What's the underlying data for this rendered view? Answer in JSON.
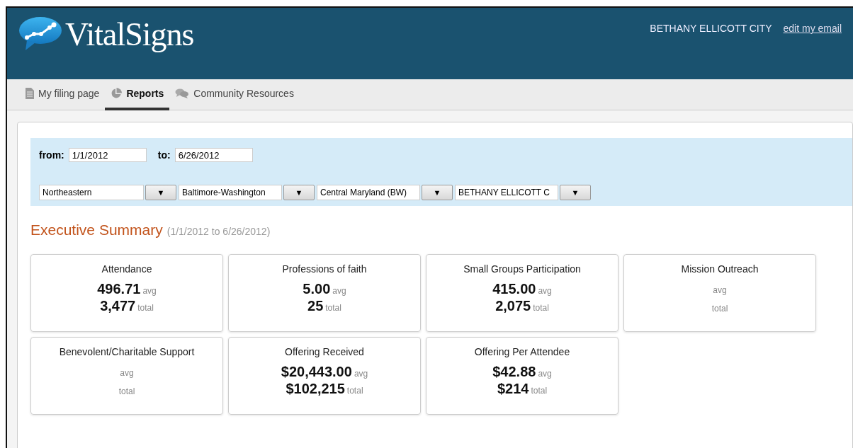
{
  "header": {
    "logo_text": "VitalSigns",
    "user": "BETHANY ELLICOTT CITY",
    "link": "edit my email"
  },
  "nav": [
    {
      "label": "My filing page",
      "selected": false
    },
    {
      "label": "Reports",
      "selected": true
    },
    {
      "label": "Community Resources",
      "selected": false
    }
  ],
  "filters": {
    "from_label": "from:",
    "from_value": "1/1/2012",
    "to_label": "to:",
    "to_value": "6/26/2012",
    "dropdowns": [
      {
        "value": "Northeastern",
        "button": "▼"
      },
      {
        "value": "Baltimore-Washington",
        "button": "▼"
      },
      {
        "value": "Central Maryland (BW)",
        "button": "▼"
      },
      {
        "value": "BETHANY ELLICOTT C",
        "button": "▼"
      }
    ]
  },
  "summary": {
    "title": "Executive Summary",
    "range": "(1/1/2012 to 6/26/2012)",
    "metrics": [
      {
        "title": "Attendance",
        "avg": {
          "value": "496.71",
          "unit": "avg"
        },
        "total": {
          "value": "3,477",
          "unit": "total"
        }
      },
      {
        "title": "Professions of faith",
        "avg": {
          "value": "5.00",
          "unit": "avg"
        },
        "total": {
          "value": "25",
          "unit": "total"
        }
      },
      {
        "title": "Small Groups Participation",
        "avg": {
          "value": "415.00",
          "unit": "avg"
        },
        "total": {
          "value": "2,075",
          "unit": "total"
        }
      },
      {
        "title": "Mission Outreach",
        "avg": {
          "unit": "avg"
        },
        "total": {
          "unit": "total"
        }
      },
      {
        "title": "Benevolent/Charitable Support",
        "avg": {
          "unit": "avg"
        },
        "total": {
          "unit": "total"
        }
      },
      {
        "title": "Offering Received",
        "avg": {
          "value": "$20,443.00",
          "unit": "avg"
        },
        "total": {
          "value": "$102,215",
          "unit": "total"
        }
      },
      {
        "title": "Offering Per Attendee",
        "avg": {
          "value": "$42.88",
          "unit": "avg"
        },
        "total": {
          "value": "$214",
          "unit": "total"
        }
      }
    ]
  }
}
